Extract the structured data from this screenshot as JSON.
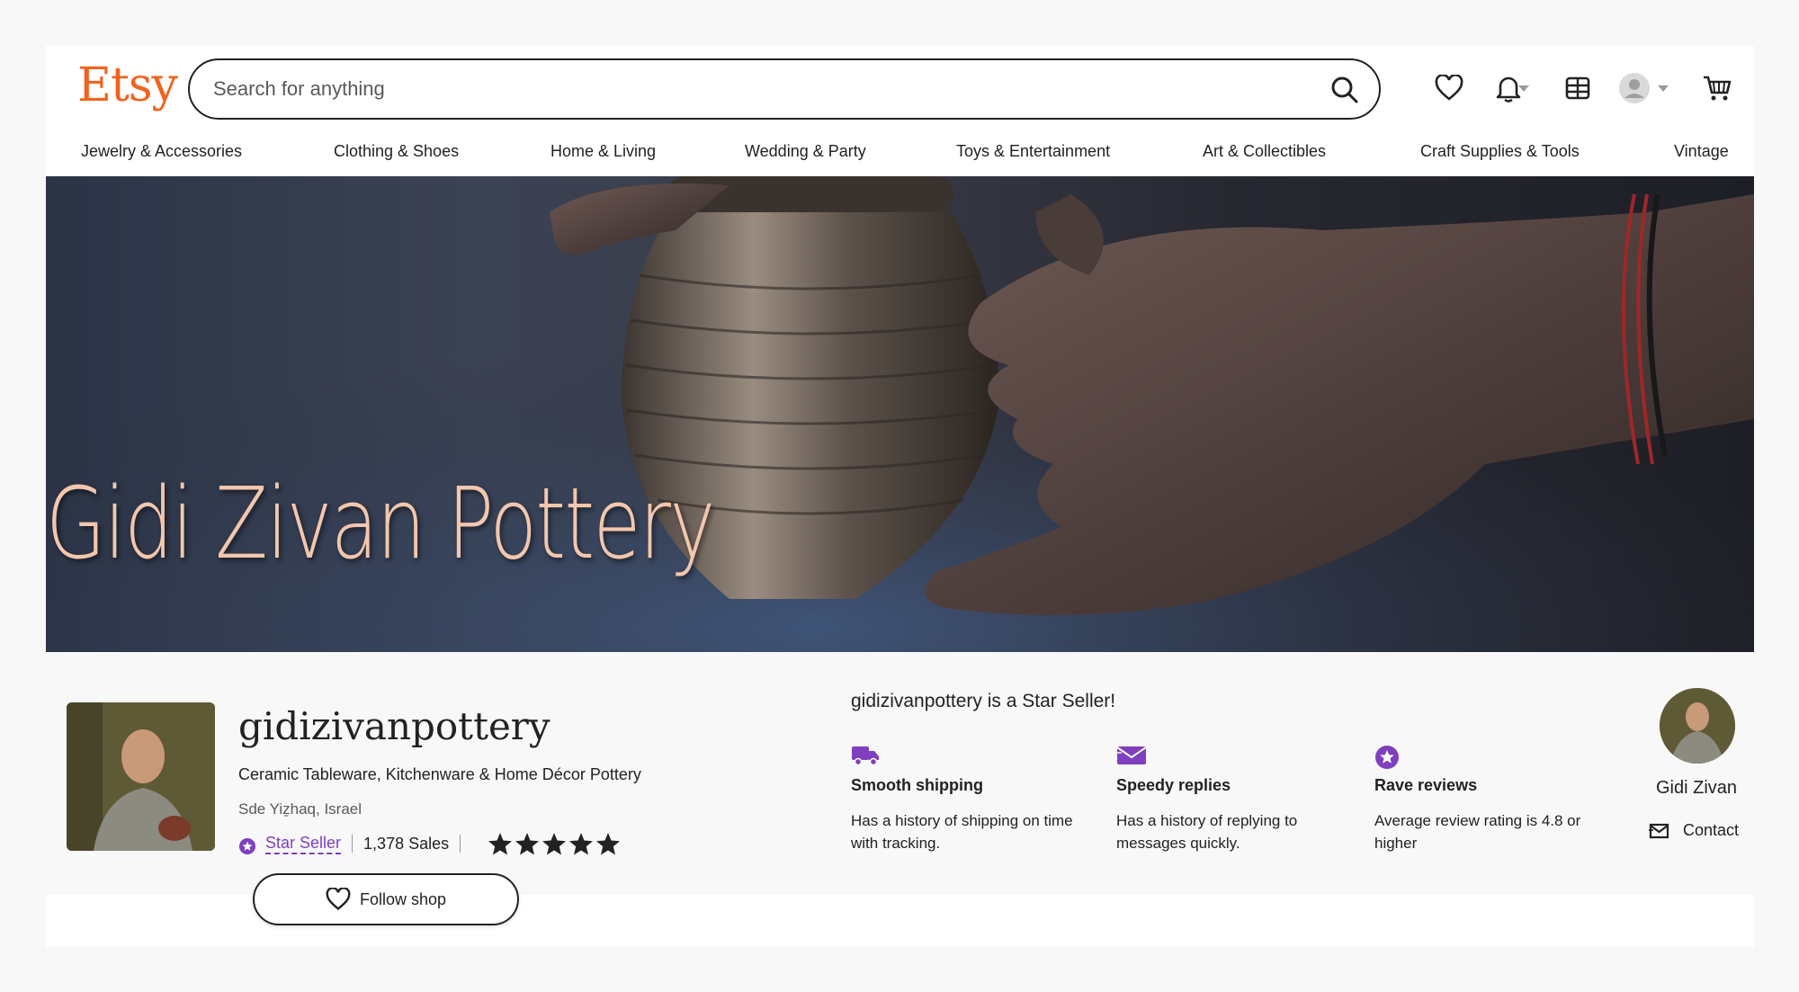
{
  "header": {
    "logo": "Etsy",
    "search_placeholder": "Search for anything",
    "icons": [
      "search-icon",
      "heart-icon",
      "bell-icon",
      "gift-icon",
      "user-icon",
      "cart-icon"
    ]
  },
  "categories": [
    "Jewelry & Accessories",
    "Clothing & Shoes",
    "Home & Living",
    "Wedding & Party",
    "Toys & Entertainment",
    "Art & Collectibles",
    "Craft Supplies & Tools",
    "Vintage"
  ],
  "banner": {
    "title": "Gidi Zivan Pottery"
  },
  "shop": {
    "name": "gidizivanpottery",
    "description": "Ceramic Tableware, Kitchenware & Home Décor Pottery",
    "location": "Sde Yiẕhaq, Israel",
    "star_seller_label": "Star Seller",
    "sales": "1,378 Sales",
    "rating_stars": 5,
    "follow_label": "Follow shop"
  },
  "star_seller": {
    "heading": "gidizivanpottery is a Star Seller!",
    "features": [
      {
        "icon": "truck-icon",
        "title": "Smooth shipping",
        "desc": "Has a history of shipping on time with tracking."
      },
      {
        "icon": "envelope-icon",
        "title": "Speedy replies",
        "desc": "Has a history of replying to messages quickly."
      },
      {
        "icon": "star-badge-icon",
        "title": "Rave reviews",
        "desc": "Average review rating is 4.8 or higher"
      }
    ]
  },
  "owner": {
    "name": "Gidi Zivan",
    "contact_label": "Contact"
  },
  "colors": {
    "brand": "#f1641e",
    "star_seller_purple": "#7f3fbf",
    "banner_text": "#f2c7ad"
  }
}
